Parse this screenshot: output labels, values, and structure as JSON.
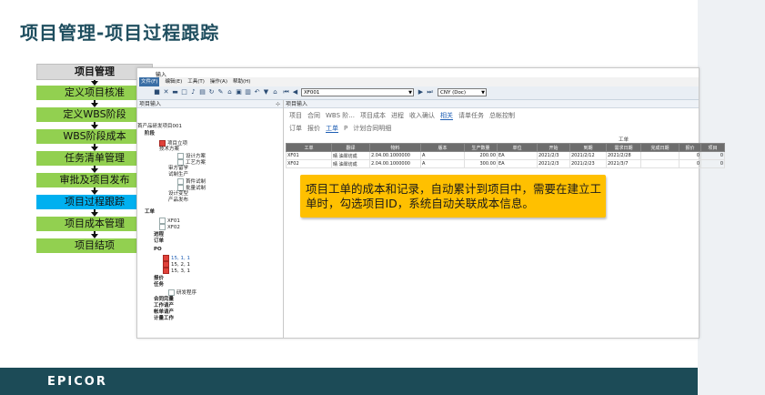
{
  "slide": {
    "title": "项目管理-项目过程跟踪",
    "footer_logo": "EPICOR"
  },
  "flow": {
    "header": "项目管理",
    "steps": [
      {
        "label": "定义项目核准",
        "active": false
      },
      {
        "label": "定义WBS阶段",
        "active": false
      },
      {
        "label": "WBS阶段成本",
        "active": false
      },
      {
        "label": "任务清单管理",
        "active": false
      },
      {
        "label": "审批及项目发布",
        "active": false
      },
      {
        "label": "项目过程跟踪",
        "active": true
      },
      {
        "label": "项目成本管理",
        "active": false
      },
      {
        "label": "项目结项",
        "active": false
      }
    ]
  },
  "app": {
    "title": "输入",
    "menu": [
      "文件(F)",
      "编辑(E)",
      "工具(T)",
      "操作(A)",
      "帮助(H)"
    ],
    "project_select": "XF001",
    "currency_select": "CNY (Doc)",
    "left_pane_title": "项目输入",
    "right_pane_title": "项目输入",
    "tree": [
      "首产品研发项目001",
      "阶段",
      "项目立项",
      "技术方案",
      "设计方案",
      "工艺方案",
      "审方留学",
      "试制生产",
      "首件试制",
      "批量试制",
      "设计变型",
      "产品发布",
      "工单",
      "XF01",
      "XF02",
      "进程",
      "订单",
      "PO",
      "15, 1, 1",
      "15, 2, 1",
      "15, 3, 1",
      "报价",
      "任务",
      "研发程序",
      "合同完量",
      "工作请产",
      "帐单请产",
      "计量工作"
    ],
    "tabs_row1": [
      "项目",
      "合同",
      "WBS 阶...",
      "项目成本",
      "进程",
      "收入确认",
      "相关",
      "请单任务",
      "总帐控制"
    ],
    "tabs_row1_active": "相关",
    "tabs_row2": [
      "订单",
      "报价",
      "工单",
      "P",
      "计划合同明细"
    ],
    "tabs_row2_active": "工单",
    "grid_caption": "工单",
    "grid_columns": [
      "工单",
      "翻译",
      "物料",
      "版本",
      "生产数量",
      "单位",
      "开始",
      "到期",
      "需求日期",
      "完成日期",
      "报价",
      "项目"
    ],
    "grid_rows": [
      [
        "XF01",
        "晴 油翠坊成",
        "2.04.00.1000000",
        "A",
        "200.00",
        "EA",
        "2021/2/3",
        "2021/2/12",
        "2021/2/28",
        "",
        "0",
        "0"
      ],
      [
        "XF02",
        "晴 油翠坊成",
        "2.04.00.1000000",
        "A",
        "300.00",
        "EA",
        "2021/2/3",
        "2021/2/23",
        "2021/3/7",
        "",
        "0",
        "0"
      ]
    ]
  },
  "callout": {
    "text": "项目工单的成本和记录，自动累计到项目中，需要在建立工单时，勾选项目ID，系统自动关联成本信息。"
  },
  "colors": {
    "title": "#1f4e5f",
    "flow_step": "#92d050",
    "flow_active": "#00b0f0",
    "footer": "#1c4b57",
    "callout": "#ffc000"
  }
}
